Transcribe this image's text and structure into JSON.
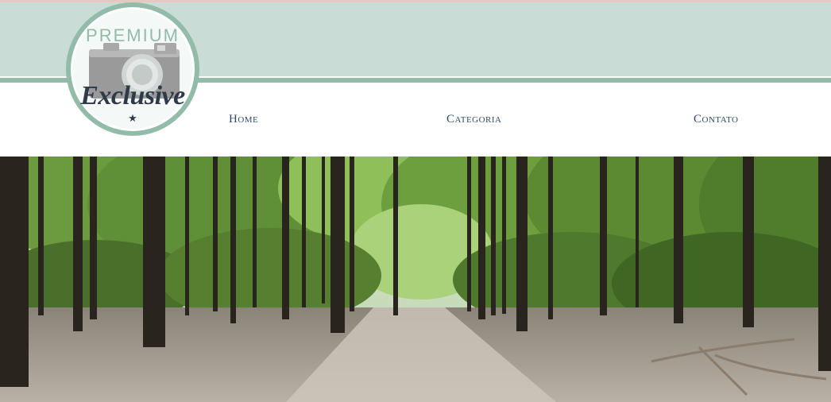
{
  "logo": {
    "top_text": "PREMIUM",
    "script_text": "Exclusive",
    "star": "★",
    "colors": {
      "ring": "#93bba9",
      "text": "#2e3a48",
      "camera": "#9a9a9a"
    }
  },
  "nav": {
    "items": [
      {
        "label": "Home"
      },
      {
        "label": "Categoria"
      },
      {
        "label": "Contato"
      }
    ]
  },
  "hero": {
    "image": "forest-path-photo"
  },
  "colors": {
    "banner": "#c9ddd6",
    "banner_stripe": "#93bba9",
    "nav_text": "#2e4a66"
  }
}
